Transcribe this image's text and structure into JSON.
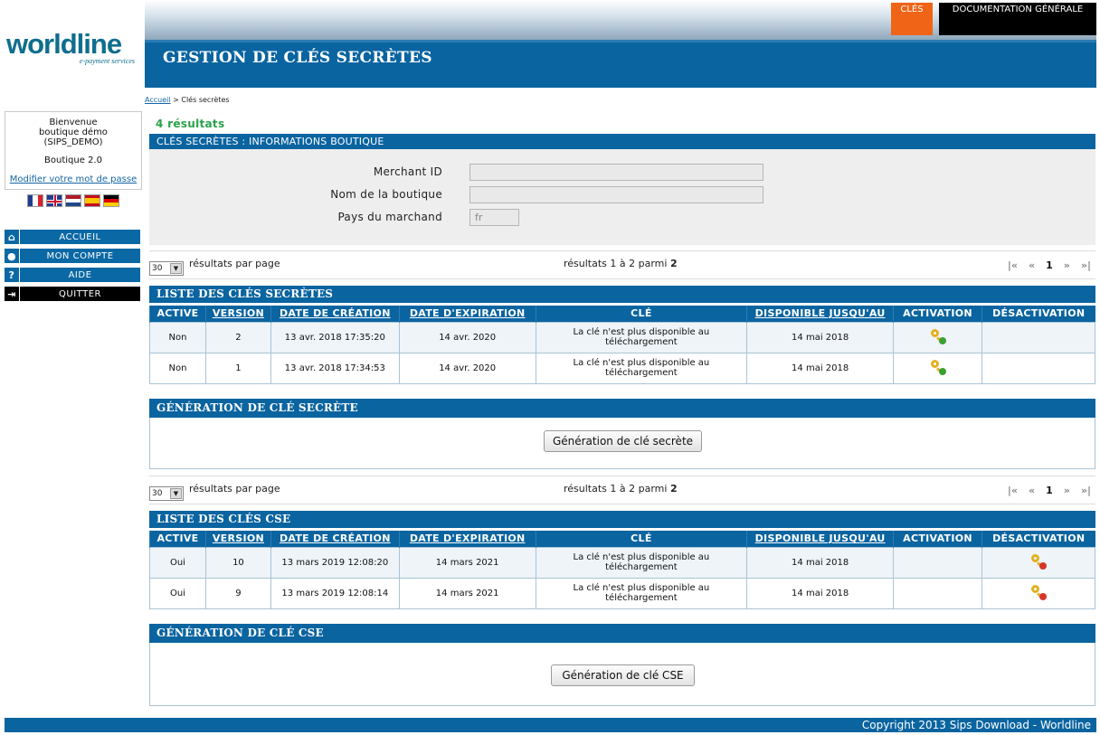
{
  "brand": {
    "name": "worldline",
    "tagline": "e-payment services"
  },
  "header": {
    "tabs": [
      {
        "label": "CLÉS",
        "color": "#f06418"
      },
      {
        "label": "DOCUMENTATION GÉNÉRALE",
        "color": "#000000"
      }
    ],
    "title": "GESTION DE CLÉS SECRÈTES"
  },
  "breadcrumb": {
    "home": "Accueil",
    "separator": ">",
    "current": "Clés secrètes"
  },
  "welcome": {
    "line1": "Bienvenue",
    "line2": "boutique démo",
    "line3": "(SIPS_DEMO)",
    "shop": "Boutique 2.0",
    "change_password": "Modifier votre mot de passe"
  },
  "languages": [
    "fr",
    "en",
    "nl",
    "es",
    "de"
  ],
  "nav": [
    {
      "label": "ACCUEIL",
      "icon": "home-icon"
    },
    {
      "label": "MON COMPTE",
      "icon": "user-icon"
    },
    {
      "label": "AIDE",
      "icon": "help-icon"
    },
    {
      "label": "QUITTER",
      "icon": "exit-icon"
    }
  ],
  "results_count": "4 résultats",
  "info": {
    "bar": "CLÉS SECRÈTES   :   INFORMATIONS BOUTIQUE",
    "merchant_id_label": "Merchant ID",
    "merchant_id_value": "",
    "shop_name_label": "Nom de la boutique",
    "shop_name_value": "",
    "country_label": "Pays du marchand",
    "country_value": "fr"
  },
  "pager": {
    "per_page_value": "30",
    "per_page_label": "résultats par page",
    "range_text": "résultats 1 à 2 parmi",
    "total": "2",
    "current_page": "1",
    "first": "|«",
    "prev": "«",
    "next": "»",
    "last": "»|"
  },
  "columns": {
    "active": "ACTIVE",
    "version": "VERSION",
    "created": "DATE DE CRÉATION",
    "expires": "DATE D'EXPIRATION",
    "key": "CLÉ",
    "available": "DISPONIBLE JUSQU'AU",
    "activation": "ACTIVATION",
    "deactivation": "DÉSACTIVATION"
  },
  "secret_keys": {
    "title": "LISTE DES CLÉS SECRÈTES",
    "rows": [
      {
        "active": "Non",
        "version": "2",
        "created": "13 avr. 2018 17:35:20",
        "expires": "14 avr. 2020",
        "key": "La clé n'est plus disponible au téléchargement",
        "available": "14 mai 2018",
        "action": "activate"
      },
      {
        "active": "Non",
        "version": "1",
        "created": "13 avr. 2018 17:34:53",
        "expires": "14 avr. 2020",
        "key": "La clé n'est plus disponible au téléchargement",
        "available": "14 mai 2018",
        "action": "activate"
      }
    ]
  },
  "gen_secret": {
    "title": "GÉNÉRATION DE CLÉ SECRÈTE",
    "button": "Génération de clé secrète"
  },
  "cse_keys": {
    "title": "LISTE DES CLÉS CSE",
    "rows": [
      {
        "active": "Oui",
        "version": "10",
        "created": "13 mars 2019 12:08:20",
        "expires": "14 mars 2021",
        "key": "La clé n'est plus disponible au téléchargement",
        "available": "14 mai 2018",
        "action": "deactivate"
      },
      {
        "active": "Oui",
        "version": "9",
        "created": "13 mars 2019 12:08:14",
        "expires": "14 mars 2021",
        "key": "La clé n'est plus disponible au téléchargement",
        "available": "14 mai 2018",
        "action": "deactivate"
      }
    ]
  },
  "gen_cse": {
    "title": "GÉNÉRATION DE CLÉ CSE",
    "button": "Génération de clé CSE"
  },
  "footer": "Copyright 2013 Sips Download - Worldline"
}
